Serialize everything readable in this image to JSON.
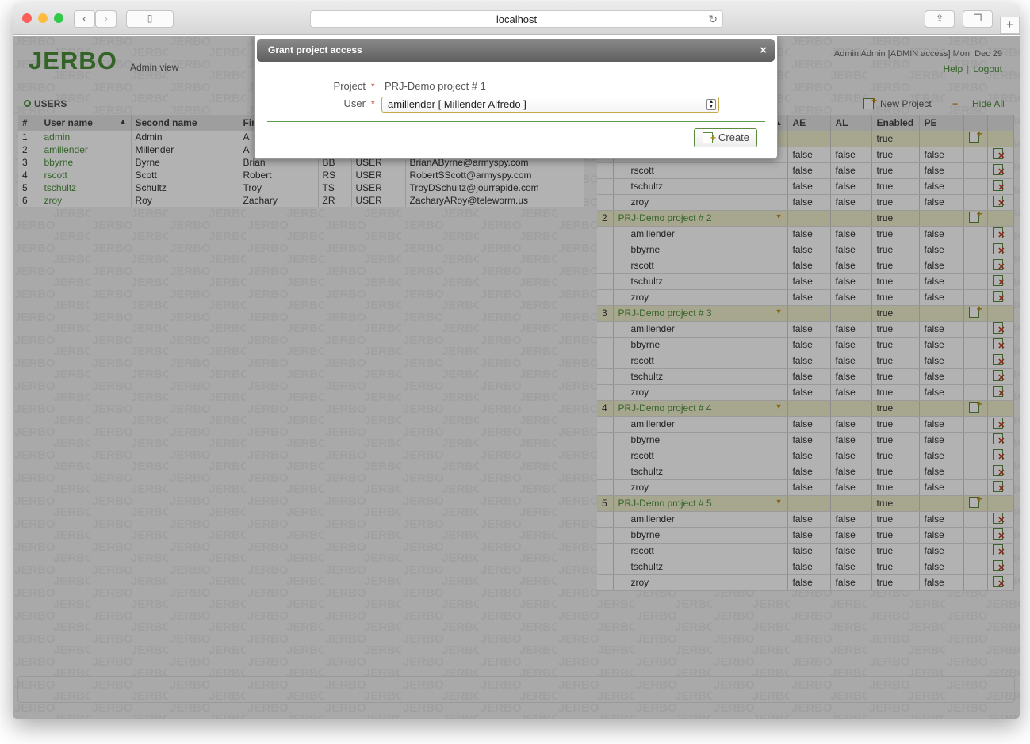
{
  "browser": {
    "url": "localhost"
  },
  "app": {
    "logo": "JERBO",
    "view_label": "Admin view",
    "watermark": "JERBO",
    "user_info": "Admin Admin   [ADMIN access]   Mon, Dec 29",
    "help": "Help",
    "logout": "Logout"
  },
  "users_panel": {
    "title": "USERS",
    "columns": [
      "#",
      "User name",
      "Second name",
      "Fir"
    ],
    "rows": [
      {
        "n": "1",
        "username": "admin",
        "second": "Admin",
        "first": "A",
        "initials": "",
        "role": "",
        "email": ""
      },
      {
        "n": "2",
        "username": "amillender",
        "second": "Millender",
        "first": "A",
        "initials": "",
        "role": "",
        "email": ""
      },
      {
        "n": "3",
        "username": "bbyrne",
        "second": "Byrne",
        "first": "Brian",
        "initials": "BB",
        "role": "USER",
        "email": "BrianAByrne@armyspy.com"
      },
      {
        "n": "4",
        "username": "rscott",
        "second": "Scott",
        "first": "Robert",
        "initials": "RS",
        "role": "USER",
        "email": "RobertSScott@armyspy.com"
      },
      {
        "n": "5",
        "username": "tschultz",
        "second": "Schultz",
        "first": "Troy",
        "initials": "TS",
        "role": "USER",
        "email": "TroyDSchultz@jourrapide.com"
      },
      {
        "n": "6",
        "username": "zroy",
        "second": "Roy",
        "first": "Zachary",
        "initials": "ZR",
        "role": "USER",
        "email": "ZacharyARoy@teleworm.us"
      }
    ]
  },
  "projects_panel": {
    "new_project": "New Project",
    "hide_all": "Hide All",
    "columns": [
      "AE",
      "AL",
      "Enabled",
      "PE"
    ],
    "partial_users": [
      "rscott",
      "tschultz",
      "zroy"
    ],
    "users": [
      "amillender",
      "bbyrne",
      "rscott",
      "tschultz",
      "zroy"
    ],
    "projects": [
      {
        "n": "2",
        "name": "PRJ-Demo project # 2"
      },
      {
        "n": "3",
        "name": "PRJ-Demo project # 3"
      },
      {
        "n": "4",
        "name": "PRJ-Demo project # 4"
      },
      {
        "n": "5",
        "name": "PRJ-Demo project # 5"
      }
    ],
    "false_text": "false",
    "true_text": "true"
  },
  "dialog": {
    "title": "Grant project access",
    "close": "×",
    "project_label": "Project",
    "project_value": "PRJ-Demo project # 1",
    "user_label": "User",
    "required_mark": "*",
    "user_value": "amillender [ Millender Alfredo ]",
    "create_label": "Create"
  }
}
